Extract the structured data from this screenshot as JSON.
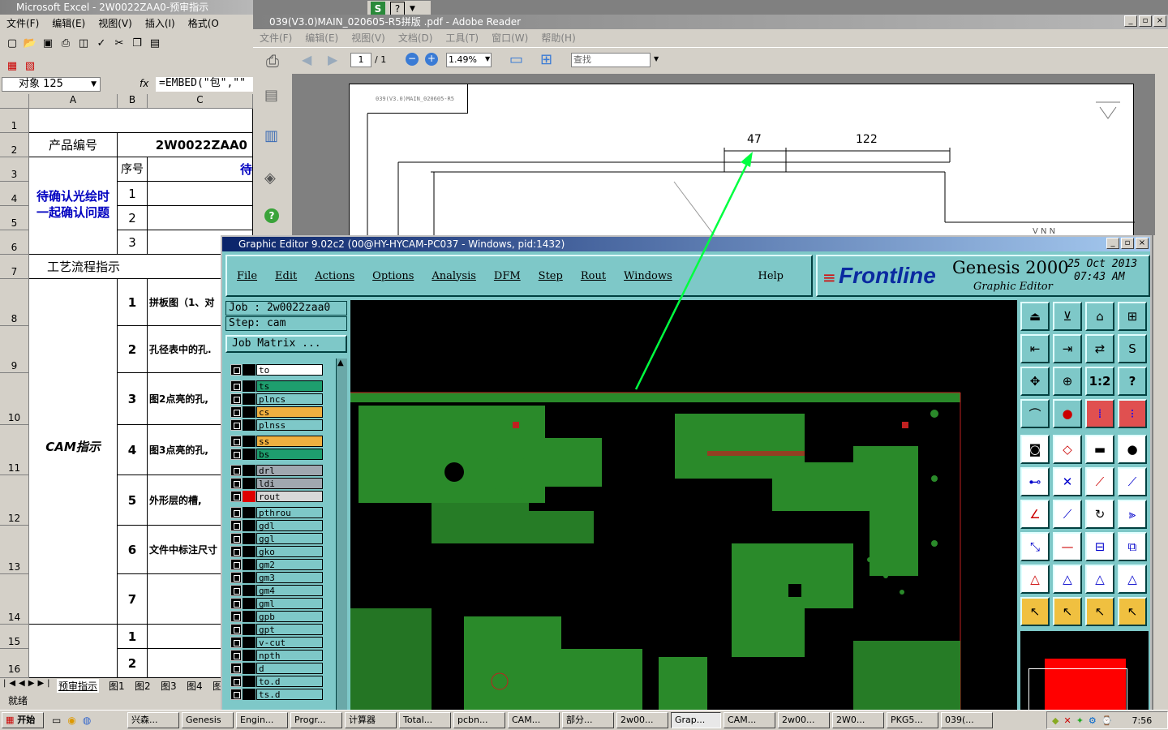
{
  "excel": {
    "title": "Microsoft Excel - 2W0022ZAA0-预审指示",
    "menu": [
      "文件(F)",
      "编辑(E)",
      "视图(V)",
      "插入(I)",
      "格式(O"
    ],
    "namebox": "对象 125",
    "fx": "fx",
    "formula": "=EMBED(\"包\",\"\"",
    "cols": [
      "A",
      "B",
      "C"
    ],
    "rows": [
      "1",
      "2",
      "3",
      "4",
      "5",
      "6",
      "7",
      "8",
      "9",
      "10",
      "11",
      "12",
      "13",
      "14",
      "15",
      "16"
    ],
    "cells": {
      "product_label": "产品编号",
      "product_value": "2W0022ZAA0",
      "seq_header": "序号",
      "c3_partial": "待",
      "confirm_label": "待确认光绘时一起确认问题",
      "n1": "1",
      "n2": "2",
      "n3": "3",
      "process_label": "工艺流程指示",
      "cam_label": "CAM指示",
      "c8": "拼板图（1、对",
      "c9": "孔径表中的孔.",
      "c10": "图2点亮的孔,",
      "c11": "图3点亮的孔,",
      "c12": "外形层的槽,",
      "c13": "文件中标注尺寸",
      "m1": "1",
      "m2": "2",
      "m3": "3",
      "m4": "4",
      "m5": "5",
      "m6": "6",
      "m7": "7",
      "b1": "1",
      "b2": "2"
    },
    "sheet_tabs": [
      "预审指示",
      "图1",
      "图2",
      "图3",
      "图4",
      "图"
    ],
    "status": "就绪"
  },
  "quick_icons": [
    "S",
    "?"
  ],
  "pdf": {
    "title": "039(V3.0)MAIN_020605-R5拼版 .pdf - Adobe Reader",
    "menu": [
      "文件(F)",
      "编辑(E)",
      "视图(V)",
      "文档(D)",
      "工具(T)",
      "窗口(W)",
      "帮助(H)"
    ],
    "page_current": "1",
    "page_total": "/ 1",
    "zoom": "1.49%",
    "search_placeholder": "查找",
    "stamp": "039(V3.0)MAIN_020605-R5",
    "dim1": "47",
    "dim2": "122",
    "corner_text": "V N N"
  },
  "genesis": {
    "title": "Graphic Editor 9.02c2 (00@HY-HYCAM-PC037 - Windows, pid:1432)",
    "menu": [
      "File",
      "Edit",
      "Actions",
      "Options",
      "Analysis",
      "DFM",
      "Step",
      "Rout",
      "Windows"
    ],
    "help": "Help",
    "brand": "Frontline",
    "product": "Genesis 2000",
    "subtitle": "Graphic Editor",
    "date": "25 Oct 2013",
    "time": "07:43 AM",
    "job": "Job : 2w0022zaa0",
    "step": "Step: cam",
    "job_matrix": "Job Matrix ...",
    "layers": [
      {
        "name": "to",
        "swatch": "#000000",
        "bg": "#ffffff"
      },
      {
        "name": "ts",
        "swatch": "#000000",
        "bg": "#1e9e6e"
      },
      {
        "name": "plncs",
        "swatch": "#000000",
        "bg": "#7ec8c8"
      },
      {
        "name": "cs",
        "swatch": "#000000",
        "bg": "#f0b040"
      },
      {
        "name": "plnss",
        "swatch": "#000000",
        "bg": "#7ec8c8"
      },
      {
        "name": "ss",
        "swatch": "#000000",
        "bg": "#f0b040"
      },
      {
        "name": "bs",
        "swatch": "#000000",
        "bg": "#1e9e6e"
      },
      {
        "name": "drl",
        "swatch": "#000000",
        "bg": "#a0a8b0"
      },
      {
        "name": "ldi",
        "swatch": "#000000",
        "bg": "#a0a8b0"
      },
      {
        "name": "rout",
        "swatch": "#e00000",
        "bg": "#d8d8d8"
      },
      {
        "name": "pthrou",
        "swatch": "#000000",
        "bg": "#7ec8c8"
      },
      {
        "name": "gdl",
        "swatch": "#000000",
        "bg": "#7ec8c8"
      },
      {
        "name": "ggl",
        "swatch": "#000000",
        "bg": "#7ec8c8"
      },
      {
        "name": "gko",
        "swatch": "#000000",
        "bg": "#7ec8c8"
      },
      {
        "name": "gm2",
        "swatch": "#000000",
        "bg": "#7ec8c8"
      },
      {
        "name": "gm3",
        "swatch": "#000000",
        "bg": "#7ec8c8"
      },
      {
        "name": "gm4",
        "swatch": "#000000",
        "bg": "#7ec8c8"
      },
      {
        "name": "gml",
        "swatch": "#000000",
        "bg": "#7ec8c8"
      },
      {
        "name": "gpb",
        "swatch": "#000000",
        "bg": "#7ec8c8"
      },
      {
        "name": "gpt",
        "swatch": "#000000",
        "bg": "#7ec8c8"
      },
      {
        "name": "v-cut",
        "swatch": "#000000",
        "bg": "#7ec8c8"
      },
      {
        "name": "npth",
        "swatch": "#000000",
        "bg": "#7ec8c8"
      },
      {
        "name": "d",
        "swatch": "#000000",
        "bg": "#7ec8c8"
      },
      {
        "name": "to.d",
        "swatch": "#000000",
        "bg": "#7ec8c8"
      },
      {
        "name": "ts.d",
        "swatch": "#000000",
        "bg": "#7ec8c8"
      }
    ],
    "tool_ratio": "1:2",
    "tool_help": "?"
  },
  "taskbar": {
    "start": "开始",
    "tasks": [
      "兴森...",
      "Genesis",
      "Engin...",
      "Progr...",
      "计算器",
      "Total...",
      "pcbn...",
      "CAM...",
      "部分...",
      "2w00...",
      "Grap...",
      "CAM...",
      "2w00...",
      "2W0...",
      "PKG5...",
      "039(..."
    ],
    "clock": "7:56"
  }
}
